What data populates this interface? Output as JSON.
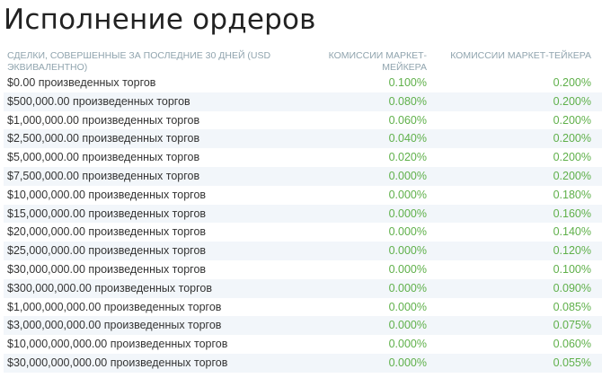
{
  "title": "Исполнение ордеров",
  "table": {
    "headers": {
      "volume": "СДЕЛКИ, СОВЕРШЕННЫЕ ЗА ПОСЛЕДНИЕ 30 ДНЕЙ (USD ЭКВИВАЛЕНТНО)",
      "maker": "КОМИССИИ МАРКЕТ-МЕЙКЕРА",
      "taker": "КОМИССИИ МАРКЕТ-ТЕЙКЕРА"
    },
    "rows": [
      {
        "volume": "$0.00 произведенных торгов",
        "maker": "0.100%",
        "taker": "0.200%"
      },
      {
        "volume": "$500,000.00 произведенных торгов",
        "maker": "0.080%",
        "taker": "0.200%"
      },
      {
        "volume": "$1,000,000.00 произведенных торгов",
        "maker": "0.060%",
        "taker": "0.200%"
      },
      {
        "volume": "$2,500,000.00 произведенных торгов",
        "maker": "0.040%",
        "taker": "0.200%"
      },
      {
        "volume": "$5,000,000.00 произведенных торгов",
        "maker": "0.020%",
        "taker": "0.200%"
      },
      {
        "volume": "$7,500,000.00 произведенных торгов",
        "maker": "0.000%",
        "taker": "0.200%"
      },
      {
        "volume": "$10,000,000.00 произведенных торгов",
        "maker": "0.000%",
        "taker": "0.180%"
      },
      {
        "volume": "$15,000,000.00 произведенных торгов",
        "maker": "0.000%",
        "taker": "0.160%"
      },
      {
        "volume": "$20,000,000.00 произведенных торгов",
        "maker": "0.000%",
        "taker": "0.140%"
      },
      {
        "volume": "$25,000,000.00 произведенных торгов",
        "maker": "0.000%",
        "taker": "0.120%"
      },
      {
        "volume": "$30,000,000.00 произведенных торгов",
        "maker": "0.000%",
        "taker": "0.100%"
      },
      {
        "volume": "$300,000,000.00 произведенных торгов",
        "maker": "0.000%",
        "taker": "0.090%"
      },
      {
        "volume": "$1,000,000,000.00 произведенных торгов",
        "maker": "0.000%",
        "taker": "0.085%"
      },
      {
        "volume": "$3,000,000,000.00 произведенных торгов",
        "maker": "0.000%",
        "taker": "0.075%"
      },
      {
        "volume": "$10,000,000,000.00 произведенных торгов",
        "maker": "0.000%",
        "taker": "0.060%"
      },
      {
        "volume": "$30,000,000,000.00 произведенных торгов",
        "maker": "0.000%",
        "taker": "0.055%"
      }
    ]
  },
  "colors": {
    "fee_value": "#5fb04a",
    "header_text": "#90a4ae",
    "row_stripe": "#f2f6fa"
  }
}
